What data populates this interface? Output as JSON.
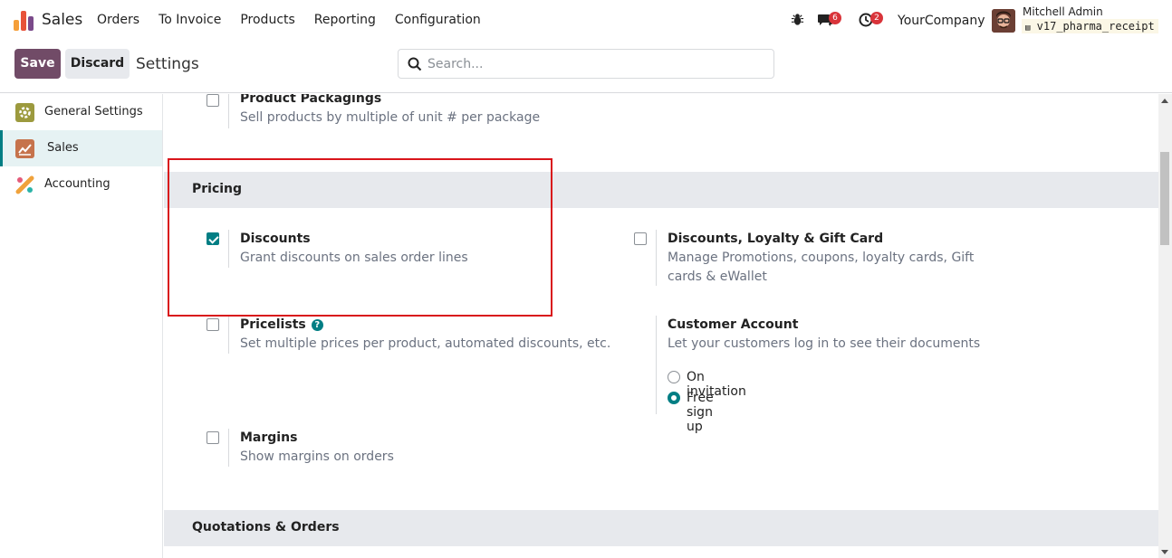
{
  "app": {
    "name": "Sales",
    "menu": [
      "Orders",
      "To Invoice",
      "Products",
      "Reporting",
      "Configuration"
    ]
  },
  "systray": {
    "messages_count": "6",
    "activities_count": "2",
    "company": "YourCompany",
    "user_name": "Mitchell Admin",
    "database": "v17_pharma_receipt"
  },
  "control": {
    "save_label": "Save",
    "discard_label": "Discard",
    "title": "Settings",
    "search_placeholder": "Search..."
  },
  "sidebar": {
    "items": [
      {
        "label": "General Settings",
        "icon": "gear-icon"
      },
      {
        "label": "Sales",
        "icon": "sales-chart-icon",
        "active": true
      },
      {
        "label": "Accounting",
        "icon": "accounting-icon"
      }
    ]
  },
  "settings": {
    "packaging": {
      "title": "Product Packagings",
      "desc": "Sell products by multiple of unit # per package",
      "checked": false
    },
    "pricing_header": "Pricing",
    "discounts": {
      "title": "Discounts",
      "desc": "Grant discounts on sales order lines",
      "checked": true
    },
    "loyalty": {
      "title": "Discounts, Loyalty & Gift Card",
      "desc": "Manage Promotions, coupons, loyalty cards, Gift cards & eWallet",
      "checked": false
    },
    "pricelists": {
      "title": "Pricelists",
      "desc": "Set multiple prices per product, automated discounts, etc.",
      "checked": false
    },
    "customer_account": {
      "title": "Customer Account",
      "desc": "Let your customers log in to see their documents",
      "options": [
        "On invitation",
        "Free sign up"
      ],
      "selected": "Free sign up"
    },
    "margins": {
      "title": "Margins",
      "desc": "Show margins on orders",
      "checked": false
    },
    "quotations_header": "Quotations & Orders"
  },
  "colors": {
    "primary": "#714b67",
    "accent": "#017e84",
    "highlight": "#d9151b",
    "badge": "#d9343a"
  }
}
